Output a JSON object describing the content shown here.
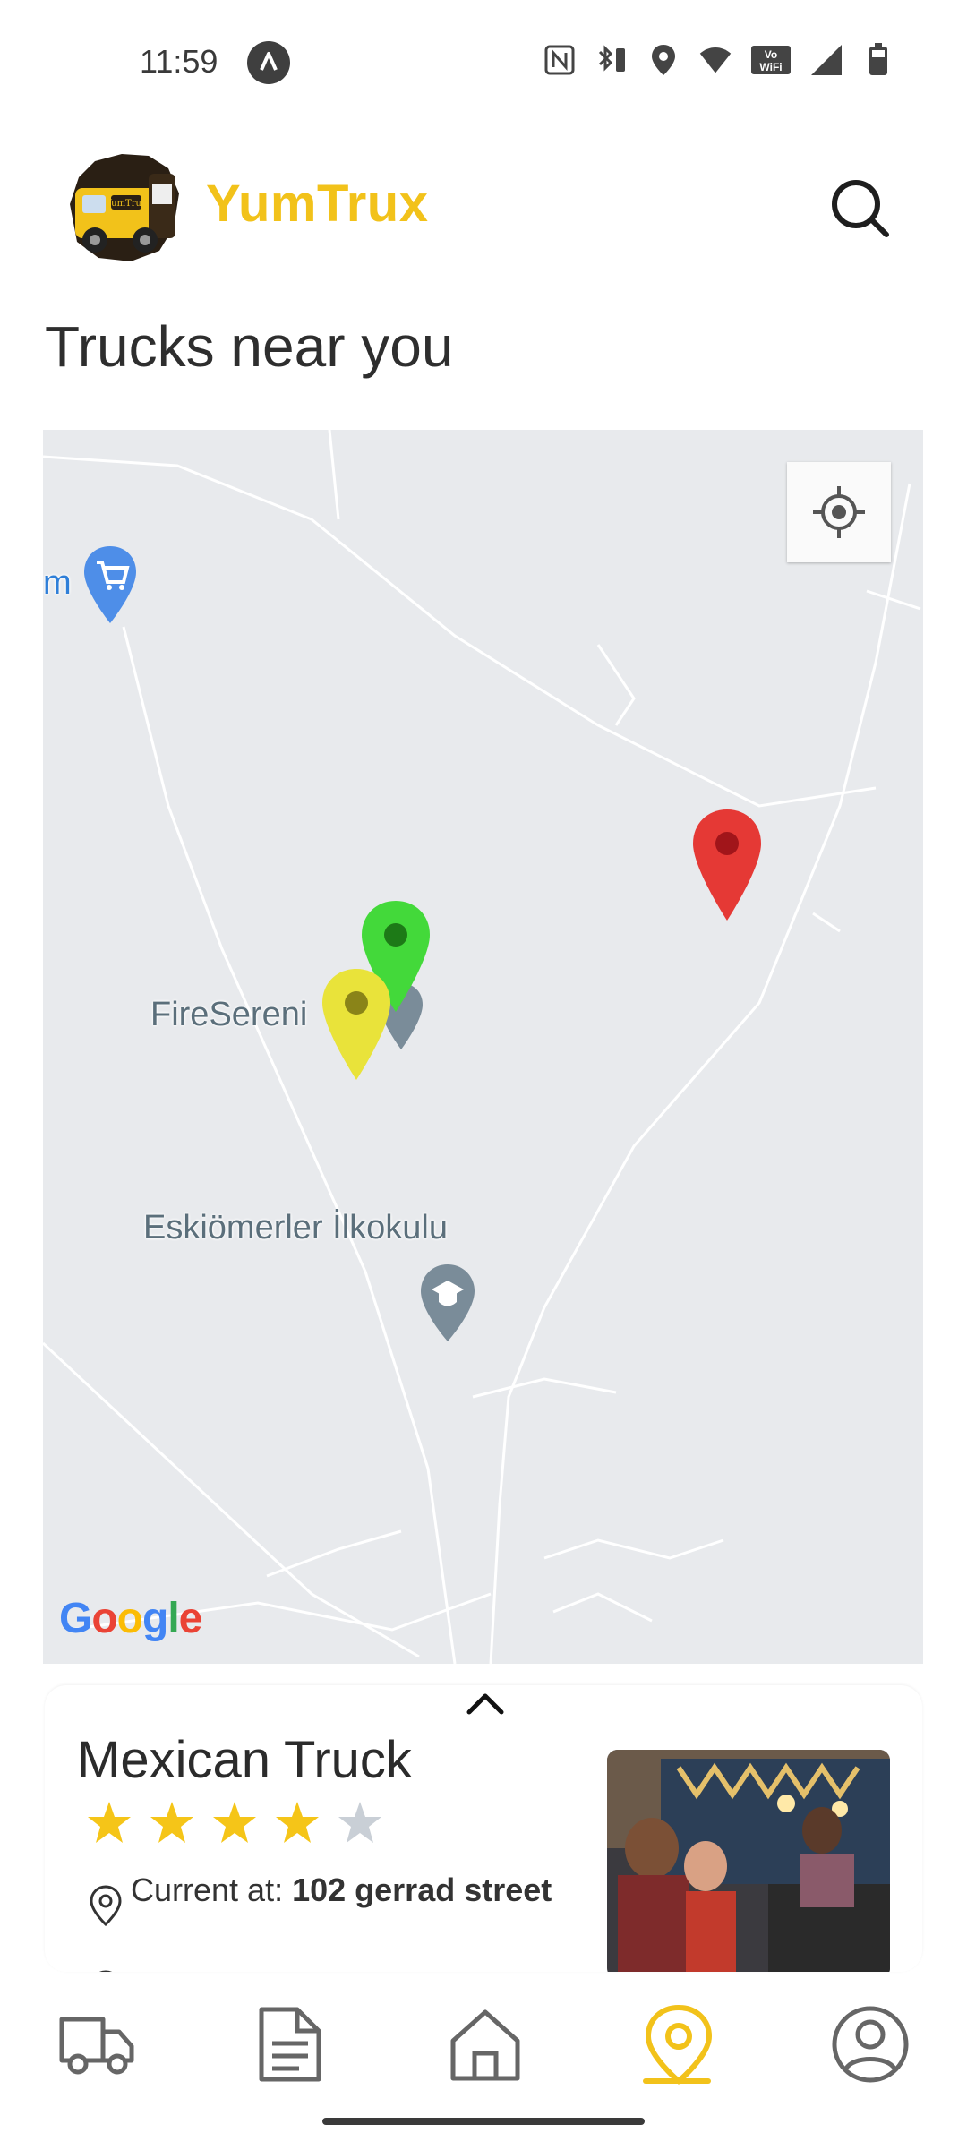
{
  "status_bar": {
    "time": "11:59",
    "icons": [
      "navigation-arrow-icon",
      "nfc-icon",
      "bluetooth-battery-icon",
      "location-icon",
      "wifi-icon",
      "vowifi-icon",
      "cell-signal-icon",
      "battery-icon"
    ],
    "vowifi_text": "Vo WiFi"
  },
  "header": {
    "brand": "YumTrux",
    "logo_text": "YumTrux",
    "brand_color": "#f2c21a"
  },
  "page": {
    "title": "Trucks near you"
  },
  "map": {
    "labels": {
      "partial_place": "m",
      "fire": "FireSereni",
      "school": "Eskiömerler İlkokulu"
    },
    "pins": [
      {
        "color": "#e53935",
        "name": "red-truck-pin"
      },
      {
        "color": "#43d93a",
        "name": "green-truck-pin"
      },
      {
        "color": "#e9e33a",
        "name": "yellow-truck-pin"
      }
    ],
    "attribution": "Google"
  },
  "truck_card": {
    "name": "Mexican Truck",
    "rating": 4,
    "max_rating": 5,
    "current_label": "Current at:",
    "address": "102 gerrad street",
    "star_color": "#f5c518",
    "star_empty_color": "#c9cfd6"
  },
  "bottom_nav": {
    "items": [
      "trucks",
      "orders",
      "home",
      "map",
      "profile"
    ],
    "active": "map",
    "active_color": "#f2c21a"
  }
}
